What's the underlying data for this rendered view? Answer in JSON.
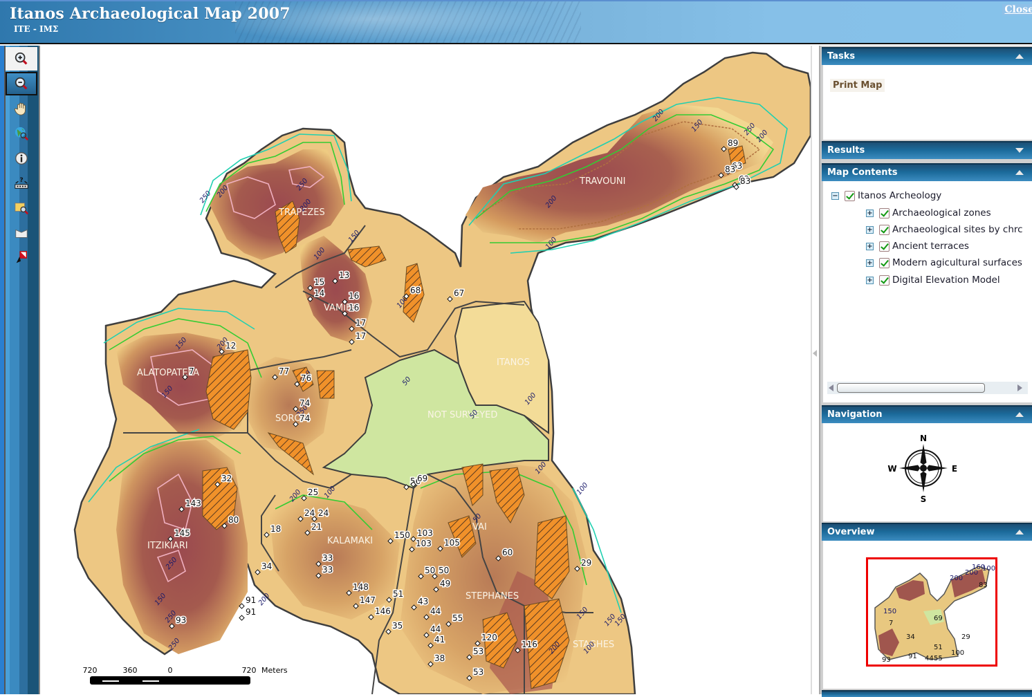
{
  "header": {
    "title": "Itanos Archaeological Map 2007",
    "subtitle": "ITE - IMΣ",
    "close_label": "Close"
  },
  "toolbar": {
    "tools": [
      {
        "name": "zoom-in",
        "icon": "zoom-in-icon",
        "state": "hover"
      },
      {
        "name": "zoom-out",
        "icon": "zoom-out-icon",
        "state": "selected"
      },
      {
        "name": "pan",
        "icon": "pan-hand-icon",
        "state": "normal"
      },
      {
        "name": "full-extent",
        "icon": "globe-zoom-icon",
        "state": "normal"
      },
      {
        "name": "identify",
        "icon": "info-icon",
        "state": "normal"
      },
      {
        "name": "measure",
        "icon": "measure-icon",
        "state": "normal"
      },
      {
        "name": "zoom-to-selection",
        "icon": "map-zoom-icon",
        "state": "normal"
      },
      {
        "name": "clear-selection",
        "icon": "eraser-icon",
        "state": "normal"
      },
      {
        "name": "select-tool",
        "icon": "select-pointer-icon",
        "state": "normal"
      }
    ]
  },
  "map": {
    "region_labels": [
      "TRAPEZES",
      "TRAVOUNI",
      "VAMIES",
      "ITANOS",
      "ALATOPATELA",
      "SOROS",
      "NOT SURVEYED",
      "ITZIKIARI",
      "KALAMAKI",
      "VAI",
      "STEPHANES",
      "STAGHES"
    ],
    "contour_labels": [
      "200",
      "250",
      "250",
      "200",
      "150",
      "250",
      "200",
      "200",
      "200",
      "150",
      "100",
      "200",
      "150",
      "100",
      "100",
      "250",
      "200",
      "150",
      "200",
      "250",
      "50",
      "100",
      "50",
      "100",
      "150",
      "250",
      "200",
      "250",
      "150",
      "50",
      "100",
      "150",
      "100",
      "50",
      "200",
      "100",
      "150"
    ],
    "site_labels": [
      "7",
      "12",
      "13",
      "14",
      "15",
      "16",
      "16",
      "17",
      "17",
      "18",
      "21",
      "24",
      "24",
      "25",
      "29",
      "32",
      "33",
      "33",
      "34",
      "35",
      "38",
      "41",
      "43",
      "44",
      "44",
      "49",
      "50",
      "50",
      "51",
      "53",
      "53",
      "55",
      "56",
      "60",
      "63",
      "63",
      "67",
      "68",
      "69",
      "74",
      "74",
      "76",
      "77",
      "80",
      "83",
      "83",
      "89",
      "91",
      "91",
      "93",
      "103",
      "103",
      "105",
      "116",
      "120",
      "143",
      "145",
      "146",
      "147",
      "148",
      "150"
    ],
    "scale_bar": {
      "ticks": [
        "720",
        "360",
        "0",
        "720"
      ],
      "unit": "Meters"
    },
    "colors": {
      "high_elevation": "#9b4a4f",
      "mid_elevation": "#c58a52",
      "low_elevation": "#ecc97f",
      "coast": "#f4e0a0",
      "not_surveyed": "#cfe6a0",
      "contour_green": "#33cc33",
      "contour_cyan": "#20d0b0",
      "hatch_orange": "#f0912a",
      "zone_border": "#444444"
    }
  },
  "right_panel": {
    "tasks": {
      "title": "Tasks",
      "items": [
        "Print Map"
      ]
    },
    "results": {
      "title": "Results"
    },
    "map_contents": {
      "title": "Map Contents",
      "root": {
        "label": "Itanos Archeology",
        "checked": true,
        "expanded": true
      },
      "layers": [
        {
          "label": "Archaeological zones",
          "checked": true
        },
        {
          "label": "Archaeological sites by chrc",
          "checked": true
        },
        {
          "label": "Ancient terraces",
          "checked": true
        },
        {
          "label": "Modern agicultural surfaces",
          "checked": true
        },
        {
          "label": "Digital Elevation Model",
          "checked": true
        }
      ]
    },
    "navigation": {
      "title": "Navigation",
      "compass": {
        "n": "N",
        "s": "S",
        "e": "E",
        "w": "W"
      }
    },
    "overview": {
      "title": "Overview",
      "labels": [
        "150",
        "200",
        "200",
        "160",
        "100",
        "83",
        "7",
        "69",
        "29",
        "34",
        "51",
        "91",
        "93",
        "44",
        "55",
        "100"
      ],
      "extent_color": "#ee0000"
    }
  }
}
